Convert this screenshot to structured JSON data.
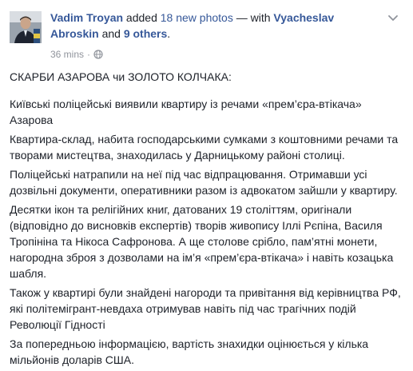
{
  "post": {
    "author_name": "Vadim Troyan",
    "action_text": " added ",
    "photos_link": "18 new photos",
    "with_text": " — with ",
    "tagged_name": "Vyacheslav Abroskin",
    "and_text": " and ",
    "others_link": "9 others",
    "period": ".",
    "timestamp": "36 mins",
    "separator": "·",
    "privacy_icon": "globe-icon",
    "options_icon": "chevron-down-icon",
    "title": "СКАРБИ АЗАРОВА чи ЗОЛОТО КОЛЧАКА:",
    "paragraphs": [
      "Київські поліцейські виявили квартиру із речами «прем’єра-втікача» Азарова",
      "Квартира-склад, набита господарськими сумками з коштовними речами та творами мистецтва, знаходилась у Дарницькому районі столиці.",
      "Поліцейські натрапили на неї під час відпрацювання. Отримавши усі дозвільні документи, оперативники разом із адвокатом зайшли у квартиру.",
      "Десятки ікон та релігійних книг, датованих 19 століттям, оригінали (відповідно до висновків експертів) творів живопису Іллі Рєпіна, Василя Тропініна та Нікоса Сафронова. А ще столове срібло, пам’ятні монети, нагородна зброя з дозволами на ім’я «прем’єра-втікача» і навіть козацька шабля.",
      "Також у квартирі були знайдені нагороди та привітання від керівництва РФ, які політемігрант-невдаха отримував навіть під час трагічних подій Революції Гідності",
      "За попередньою інформацією, вартість знахидки оцінюється у кілька мільйонів доларів США."
    ]
  },
  "colors": {
    "link": "#365899",
    "text": "#1d2129",
    "meta": "#90949c"
  }
}
